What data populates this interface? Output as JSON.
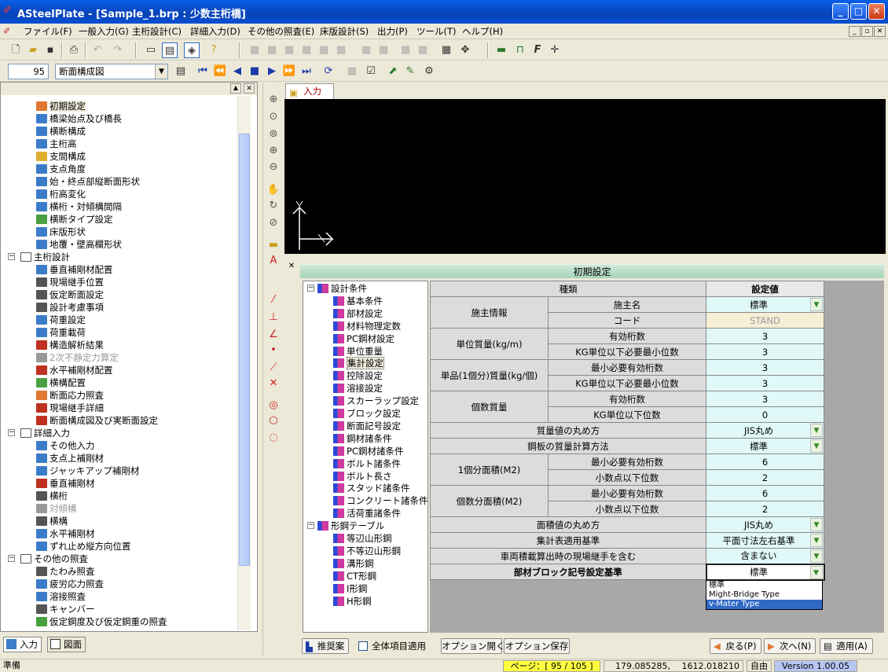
{
  "window": {
    "title": "ASteelPlate - [Sample_1.brp : 少数主桁橋]"
  },
  "menu": [
    "ファイル(F)",
    "一般入力(G)",
    "主桁設計(C)",
    "詳細入力(D)",
    "その他の照査(E)",
    "床版設計(S)",
    "出力(P)",
    "ツール(T)",
    "ヘルプ(H)"
  ],
  "toolbar2": {
    "page_number": "95",
    "view_select": "断面構成図"
  },
  "tree": {
    "items": [
      {
        "label": "初期設定",
        "color": "#e07830"
      },
      {
        "label": "橋梁始点及び橋長",
        "color": "#3a7cc8"
      },
      {
        "label": "横断構成",
        "color": "#3a7cc8"
      },
      {
        "label": "主桁高",
        "color": "#3a7cc8"
      },
      {
        "label": "支間構成",
        "color": "#e0b030"
      },
      {
        "label": "支点角度",
        "color": "#3a7cc8"
      },
      {
        "label": "始・終点部縦断面形状",
        "color": "#3a7cc8"
      },
      {
        "label": "桁高変化",
        "color": "#3a7cc8"
      },
      {
        "label": "横桁・対傾構間隔",
        "color": "#3a7cc8"
      },
      {
        "label": "横断タイプ設定",
        "color": "#4aa040"
      },
      {
        "label": "床版形状",
        "color": "#3a7cc8"
      },
      {
        "label": "地覆・壁高欄形状",
        "color": "#3a7cc8"
      }
    ],
    "group_main": "主桁設計",
    "main_items": [
      {
        "label": "垂直補剛材配置",
        "color": "#3a7cc8"
      },
      {
        "label": "現場継手位置",
        "color": "#555"
      },
      {
        "label": "仮定断面設定",
        "color": "#555"
      },
      {
        "label": "設計考慮事項",
        "color": "#555"
      },
      {
        "label": "荷重設定",
        "color": "#3a7cc8"
      },
      {
        "label": "荷重載荷",
        "color": "#3a7cc8"
      },
      {
        "label": "構造解析結果",
        "color": "#c03020"
      },
      {
        "label": "2次不静定力算定",
        "color": "#999",
        "dim": true
      },
      {
        "label": "水平補剛材配置",
        "color": "#c03020"
      },
      {
        "label": "横構配置",
        "color": "#4aa040"
      },
      {
        "label": "断面応力照査",
        "color": "#e07830"
      },
      {
        "label": "現場継手詳細",
        "color": "#c03020"
      },
      {
        "label": "断面構成図及び実断面設定",
        "color": "#c03020"
      }
    ],
    "group_detail": "詳細入力",
    "detail_items": [
      {
        "label": "その他入力",
        "color": "#3a7cc8"
      },
      {
        "label": "支点上補剛材",
        "color": "#3a7cc8"
      },
      {
        "label": "ジャッキアップ補剛材",
        "color": "#3a7cc8"
      },
      {
        "label": "垂直補剛材",
        "color": "#c03020"
      },
      {
        "label": "横桁",
        "color": "#555"
      },
      {
        "label": "対傾構",
        "color": "#999",
        "dim": true
      },
      {
        "label": "横構",
        "color": "#555"
      },
      {
        "label": "水平補剛材",
        "color": "#3a7cc8"
      },
      {
        "label": "ずれ止め縦方向位置",
        "color": "#3a7cc8"
      }
    ],
    "group_other": "その他の照査",
    "other_items": [
      {
        "label": "たわみ照査",
        "color": "#555"
      },
      {
        "label": "疲労応力照査",
        "color": "#3a7cc8"
      },
      {
        "label": "溶接照査",
        "color": "#3a7cc8"
      },
      {
        "label": "キャンバー",
        "color": "#555"
      },
      {
        "label": "仮定鋼度及び仮定鋼重の照査",
        "color": "#4aa040"
      }
    ]
  },
  "bottom_tabs": [
    "入力",
    "図面"
  ],
  "view_tab": "入力",
  "init_panel": {
    "title": "初期設定",
    "subtree_groups": [
      "設計条件",
      "形鋼テーブル"
    ],
    "subtree_design": [
      "基本条件",
      "部材設定",
      "材料物理定数",
      "PC鋼材設定",
      "単位重量",
      "集計設定",
      "控除設定",
      "溶接設定",
      "スカーラップ設定",
      "ブロック設定",
      "断面記号設定",
      "鋼材諸条件",
      "PC鋼材諸条件",
      "ボルト諸条件",
      "ボルト長さ",
      "スタッド諸条件",
      "コンクリート諸条件",
      "活荷重諸条件"
    ],
    "subtree_shapes": [
      "等辺山形鋼",
      "不等辺山形鋼",
      "溝形鋼",
      "CT形鋼",
      "I形鋼",
      "H形鋼"
    ],
    "col_kind": "種類",
    "col_value": "設定値",
    "rows": {
      "client_group": "施主情報",
      "client_name_k": "施主名",
      "client_name_v": "標準",
      "code_k": "コード",
      "code_v": "STAND",
      "unit_mass_group": "単位質量(kg/m)",
      "um_sig_k": "有効桁数",
      "um_sig_v": "3",
      "um_min_k": "KG単位以下必要最小位数",
      "um_min_v": "3",
      "single_group": "単品(1個分)質量(kg/個)",
      "sg_sig_k": "最小必要有効桁数",
      "sg_sig_v": "3",
      "sg_min_k": "KG単位以下必要最小位数",
      "sg_min_v": "3",
      "count_group": "個数質量",
      "cm_sig_k": "有効桁数",
      "cm_sig_v": "3",
      "cm_min_k": "KG単位以下位数",
      "cm_min_v": "0",
      "rounding_k": "質量値の丸め方",
      "rounding_v": "JIS丸め",
      "plate_calc_k": "鋼板の質量計算方法",
      "plate_calc_v": "標準",
      "area1_group": "1個分面積(M2)",
      "a1_sig_k": "最小必要有効桁数",
      "a1_sig_v": "6",
      "a1_dec_k": "小数点以下位数",
      "a1_dec_v": "2",
      "area_n_group": "個数分面積(M2)",
      "an_sig_k": "最小必要有効桁数",
      "an_sig_v": "6",
      "an_dec_k": "小数点以下位数",
      "an_dec_v": "2",
      "area_round_k": "面積値の丸め方",
      "area_round_v": "JIS丸め",
      "summary_k": "集計表適用基準",
      "summary_v": "平面寸法左右基準",
      "vehicle_k": "車両積載算出時の現場継手を含む",
      "vehicle_v": "含まない",
      "block_k": "部材ブロック記号設定基準",
      "block_v": "標準"
    },
    "dropdown_options": [
      "標準",
      "Might-Bridge Type",
      "v-Mater Type"
    ]
  },
  "buttons": {
    "suggest": "推奨案",
    "apply_all": "全体項目適用",
    "option_open": "オプション開く",
    "option_save": "オプション保存",
    "back": "戻る(P)",
    "next": "次へ(N)",
    "apply": "適用(A)"
  },
  "status": {
    "ready": "準備",
    "page": "ページ：[ 95 / 105 ]",
    "coords": "179.085285,　 1612.018210",
    "mode": "自由",
    "version": "Version 1.00.05"
  }
}
